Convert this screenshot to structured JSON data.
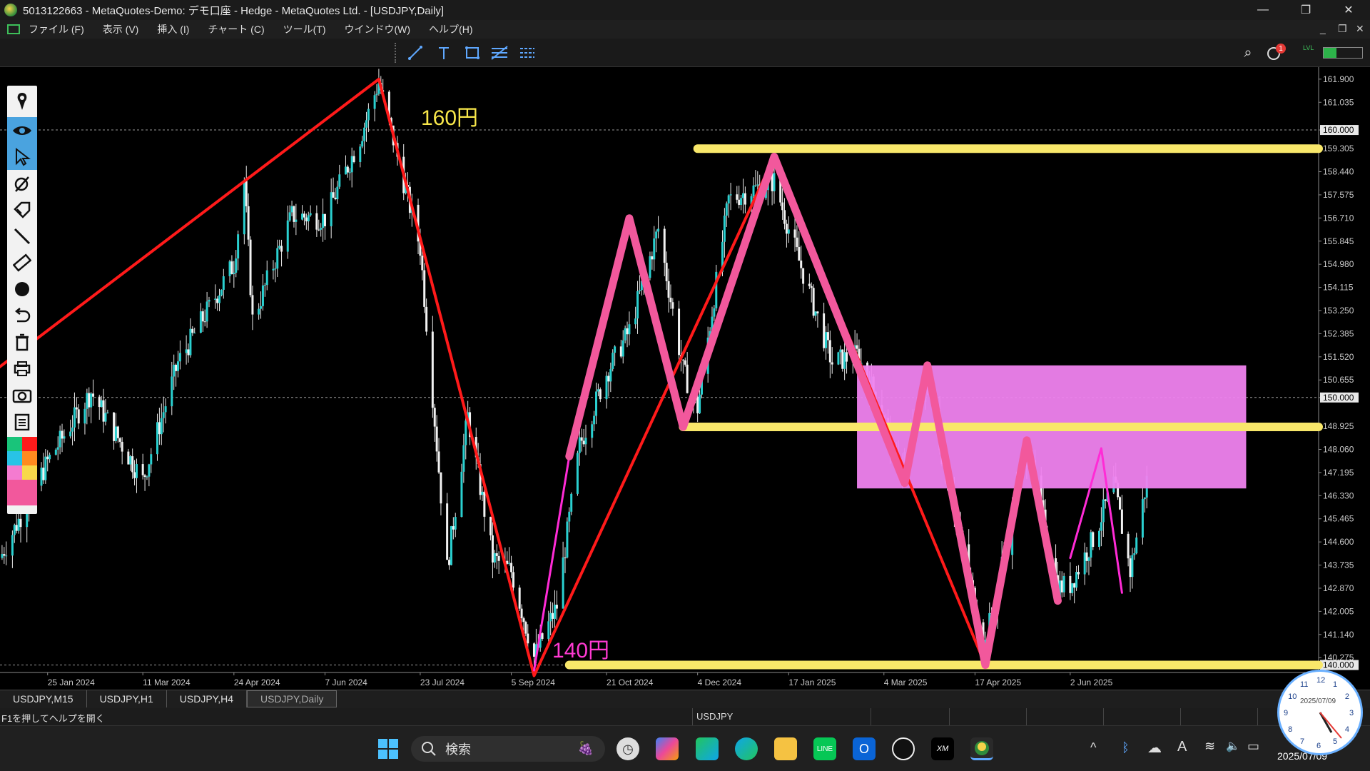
{
  "window": {
    "title": "5013122663 - MetaQuotes-Demo: デモ口座 - Hedge - MetaQuotes Ltd. - [USDJPY,Daily]",
    "minimize": "—",
    "restore": "❐",
    "close": "✕"
  },
  "menu": [
    "ファイル (F)",
    "表示 (V)",
    "挿入 (I)",
    "チャート (C)",
    "ツール(T)",
    "ウインドウ(W)",
    "ヘルプ(H)"
  ],
  "menu_controls": {
    "minimize": "_",
    "restore": "❐",
    "close": "✕"
  },
  "toolbar": {
    "icons": [
      "trendline-icon",
      "text-icon",
      "rectangle-icon",
      "fibonacci-icon",
      "channel-icon"
    ],
    "right": {
      "search": "⌕",
      "notification_badge": "1",
      "signal": "LVL"
    }
  },
  "drawing_panel": {
    "icons": [
      "pen-icon",
      "eye-icon",
      "cursor-icon",
      "eraser-icon",
      "tag-icon",
      "line-icon",
      "ruler-icon",
      "dot-icon",
      "undo-icon",
      "trash-icon",
      "print-icon",
      "camera-icon",
      "clipboard-icon"
    ],
    "colors": [
      "#19c47a",
      "#ff1b1b",
      "#28c3e6",
      "#ff8a1f",
      "#f47bd0",
      "#f8d84a",
      "#f2589c"
    ]
  },
  "chart_data": {
    "type": "candlestick",
    "symbol": "USDJPY",
    "timeframe": "Daily",
    "y_axis": {
      "ylim": [
        139.72,
        162.35
      ],
      "ticks": [
        "161.900",
        "161.035",
        "160.000",
        "159.305",
        "158.440",
        "157.575",
        "156.710",
        "155.845",
        "154.980",
        "154.115",
        "153.250",
        "152.385",
        "151.520",
        "150.655",
        "150.000",
        "148.925",
        "148.060",
        "147.195",
        "146.330",
        "145.465",
        "144.600",
        "143.735",
        "142.870",
        "142.005",
        "141.140",
        "140.275",
        "140.000"
      ],
      "tick_values": [
        161.9,
        161.035,
        160.0,
        159.305,
        158.44,
        157.575,
        156.71,
        155.845,
        154.98,
        154.115,
        153.25,
        152.385,
        151.52,
        150.655,
        150.0,
        148.925,
        148.06,
        147.195,
        146.33,
        145.465,
        144.6,
        143.735,
        142.87,
        142.005,
        141.14,
        140.275,
        140.0
      ],
      "highlighted": [
        "160.000",
        "150.000",
        "140.000"
      ],
      "highlighted_values": [
        160.0,
        150.0,
        140.0
      ]
    },
    "x_axis": {
      "labels": [
        "25 Jan 2024",
        "11 Mar 2024",
        "24 Apr 2024",
        "7 Jun 2024",
        "23 Jul 2024",
        "5 Sep 2024",
        "21 Oct 2024",
        "4 Dec 2024",
        "17 Jan 2025",
        "4 Mar 2025",
        "17 Apr 2025",
        "2 Jun 2025"
      ],
      "dates": [
        "2024-01-25",
        "2024-03-11",
        "2024-04-24",
        "2024-06-07",
        "2024-07-23",
        "2024-09-05",
        "2024-10-21",
        "2024-12-04",
        "2025-01-17",
        "2025-03-04",
        "2025-04-17",
        "2025-06-02"
      ],
      "range": [
        "2024-01-02",
        "2025-09-30"
      ]
    },
    "close_series": [
      [
        "2024-01-02",
        144.0
      ],
      [
        "2024-01-25",
        147.6
      ],
      [
        "2024-02-15",
        150.2
      ],
      [
        "2024-03-11",
        146.9
      ],
      [
        "2024-03-28",
        151.3
      ],
      [
        "2024-04-24",
        155.0
      ],
      [
        "2024-04-29",
        158.1
      ],
      [
        "2024-05-03",
        152.9
      ],
      [
        "2024-05-22",
        156.8
      ],
      [
        "2024-06-07",
        156.7
      ],
      [
        "2024-06-24",
        159.7
      ],
      [
        "2024-07-03",
        161.8
      ],
      [
        "2024-07-12",
        159.0
      ],
      [
        "2024-07-23",
        155.6
      ],
      [
        "2024-08-05",
        143.6
      ],
      [
        "2024-08-15",
        149.3
      ],
      [
        "2024-08-27",
        144.0
      ],
      [
        "2024-09-05",
        143.5
      ],
      [
        "2024-09-16",
        140.3
      ],
      [
        "2024-09-27",
        142.2
      ],
      [
        "2024-10-08",
        148.2
      ],
      [
        "2024-10-21",
        150.9
      ],
      [
        "2024-11-01",
        152.5
      ],
      [
        "2024-11-15",
        156.3
      ],
      [
        "2024-11-27",
        151.0
      ],
      [
        "2024-12-04",
        149.6
      ],
      [
        "2024-12-19",
        157.4
      ],
      [
        "2025-01-10",
        158.1
      ],
      [
        "2025-01-17",
        156.3
      ],
      [
        "2025-02-07",
        151.3
      ],
      [
        "2025-02-19",
        151.6
      ],
      [
        "2025-03-04",
        149.4
      ],
      [
        "2025-03-11",
        147.1
      ],
      [
        "2025-03-25",
        150.6
      ],
      [
        "2025-04-04",
        146.8
      ],
      [
        "2025-04-17",
        142.3
      ],
      [
        "2025-04-22",
        140.8
      ],
      [
        "2025-05-12",
        148.3
      ],
      [
        "2025-05-27",
        142.9
      ],
      [
        "2025-06-02",
        143.0
      ],
      [
        "2025-06-13",
        144.7
      ],
      [
        "2025-06-23",
        146.8
      ],
      [
        "2025-07-01",
        143.5
      ],
      [
        "2025-07-09",
        146.9
      ]
    ],
    "annotations": [
      {
        "text": "160円",
        "color": "#f8e74a"
      },
      {
        "text": "140円",
        "color": "#ff3ad3"
      }
    ],
    "levels": [
      {
        "name": "upper-resistance-line",
        "y": 159.3,
        "from": "2024-12-04",
        "to": "2025-09-30",
        "color": "#f8e76a"
      },
      {
        "name": "mid-support-line",
        "y": 148.9,
        "from": "2024-11-27",
        "to": "2025-09-30",
        "color": "#f8e76a"
      },
      {
        "name": "bottom-support-line",
        "y": 140.0,
        "from": "2024-10-03",
        "to": "2025-09-30",
        "color": "#f8e76a"
      }
    ],
    "zone": {
      "from": "2025-02-19",
      "to": "2025-08-26",
      "y_top": 151.2,
      "y_bottom": 146.6,
      "color": "#ef82ee"
    },
    "zigzags": {
      "red": [
        [
          "2023-12-27",
          150.8
        ],
        [
          "2024-07-03",
          161.9
        ],
        [
          "2024-09-16",
          139.6
        ],
        [
          "2025-01-10",
          159.0
        ],
        [
          "2025-04-22",
          140.0
        ]
      ],
      "pink": [
        [
          "2024-10-03",
          147.8
        ],
        [
          "2024-11-01",
          156.7
        ],
        [
          "2024-11-27",
          148.9
        ],
        [
          "2025-01-10",
          159.0
        ],
        [
          "2025-03-14",
          146.8
        ],
        [
          "2025-03-25",
          151.2
        ],
        [
          "2025-04-22",
          140.0
        ],
        [
          "2025-05-12",
          148.4
        ],
        [
          "2025-05-27",
          142.4
        ]
      ],
      "magenta": [
        [
          "2024-09-16",
          139.8
        ],
        [
          "2024-10-03",
          147.8
        ]
      ],
      "small": [
        [
          "2025-06-02",
          144.0
        ],
        [
          "2025-06-17",
          148.1
        ],
        [
          "2025-06-27",
          142.7
        ]
      ]
    }
  },
  "symbol_tabs": [
    "USDJPY,M15",
    "USDJPY,H1",
    "USDJPY,H4",
    "USDJPY,Daily"
  ],
  "status": {
    "help": "F1を押してヘルプを開く",
    "symbol": "USDJPY"
  },
  "taskbar": {
    "search_placeholder": "検索",
    "clock_date_face": "2025/07/09",
    "clock_time": "",
    "date": "2025/07/09",
    "clock_numerals": [
      "12",
      "1",
      "2",
      "3",
      "4",
      "5",
      "6",
      "7",
      "8",
      "9",
      "10",
      "11"
    ],
    "tray": [
      "^",
      "ᛒ",
      "☁",
      "A",
      "≋",
      "🔈",
      "▭"
    ],
    "apps": [
      "clock-app-icon",
      "copilot-icon",
      "photos-icon",
      "edge-icon",
      "explorer-icon",
      "line-icon",
      "outlook-icon",
      "tradingview-icon",
      "xm-icon",
      "metatrader-icon"
    ]
  }
}
